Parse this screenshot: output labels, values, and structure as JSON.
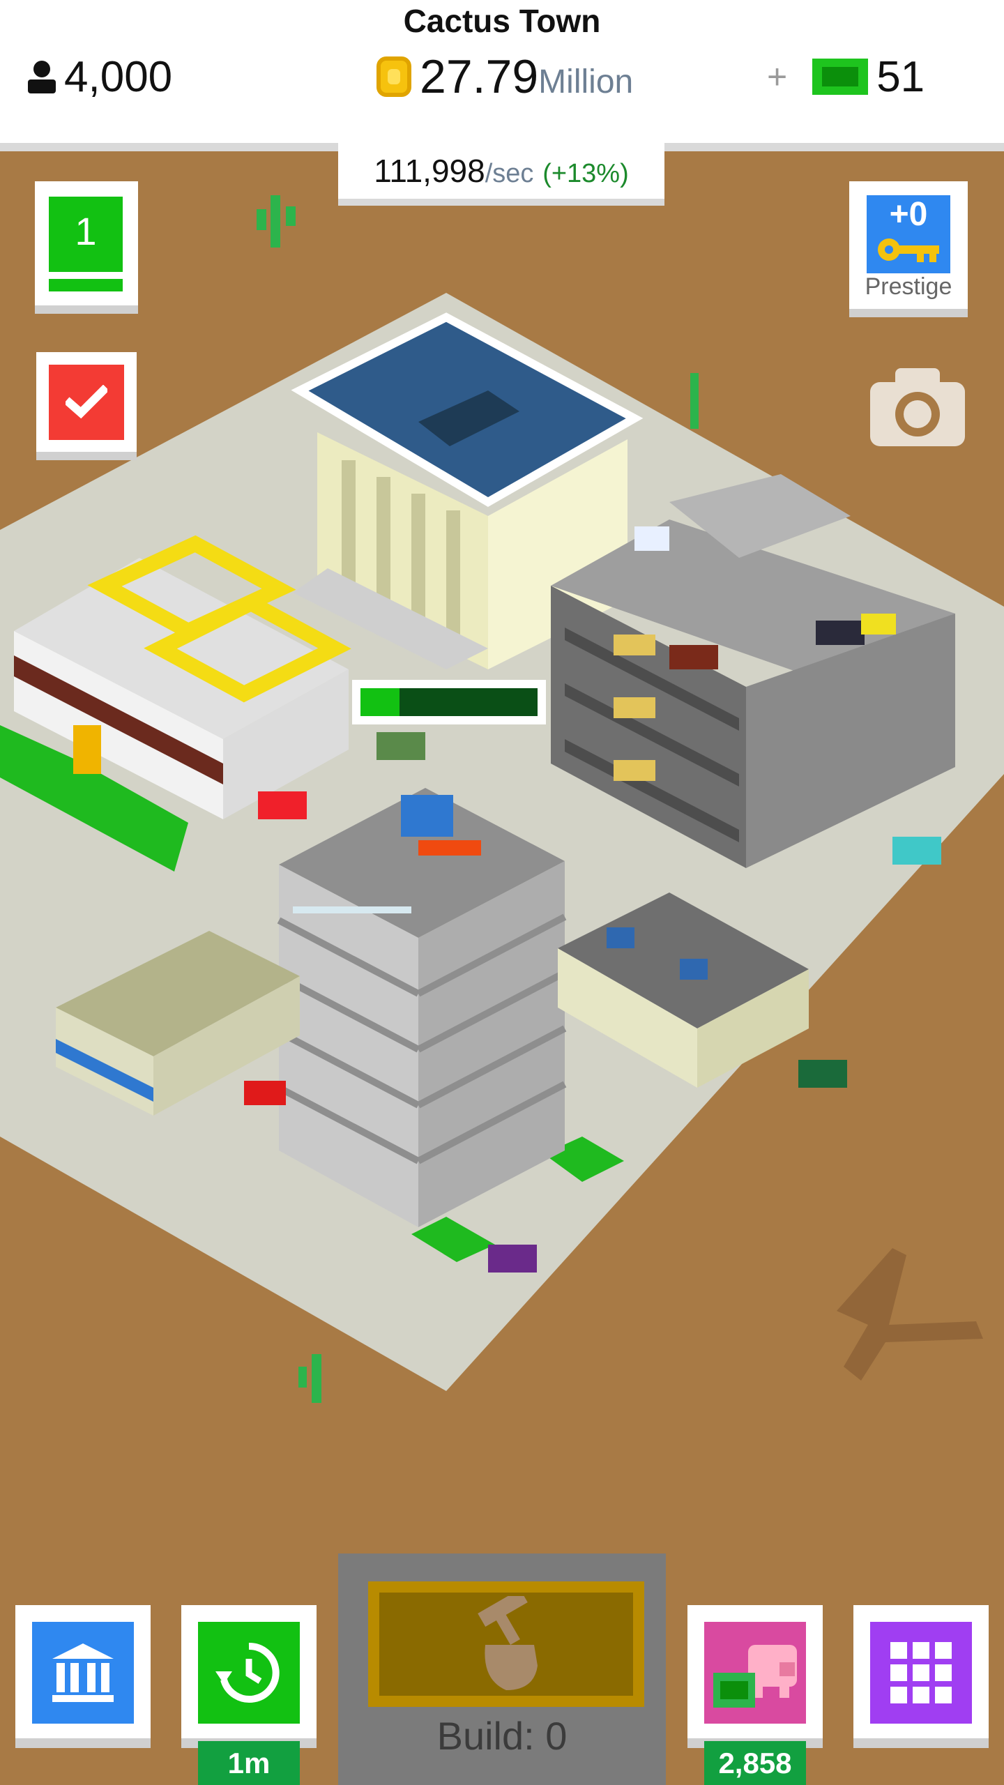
{
  "header": {
    "town_name": "Cactus Town",
    "population": "4,000",
    "coins_value": "27.79",
    "coins_unit": "Million",
    "plus": "+",
    "cash": "51"
  },
  "income": {
    "rate": "111,998",
    "unit": "/sec",
    "bonus": "(+13%)"
  },
  "level": {
    "value": "1"
  },
  "prestige": {
    "value": "+0",
    "label": "Prestige"
  },
  "construction": {
    "progress": 0.22
  },
  "bottom": {
    "offline_time": "1m",
    "build_label": "Build: 0",
    "piggy_value": "2,858"
  },
  "colors": {
    "green": "#12c112",
    "red": "#f33b34",
    "blue": "#2f88f0",
    "purple": "#a03ef2",
    "pink": "#d94aa0",
    "ground": "#a87a45",
    "road": "#d3d3c7"
  }
}
